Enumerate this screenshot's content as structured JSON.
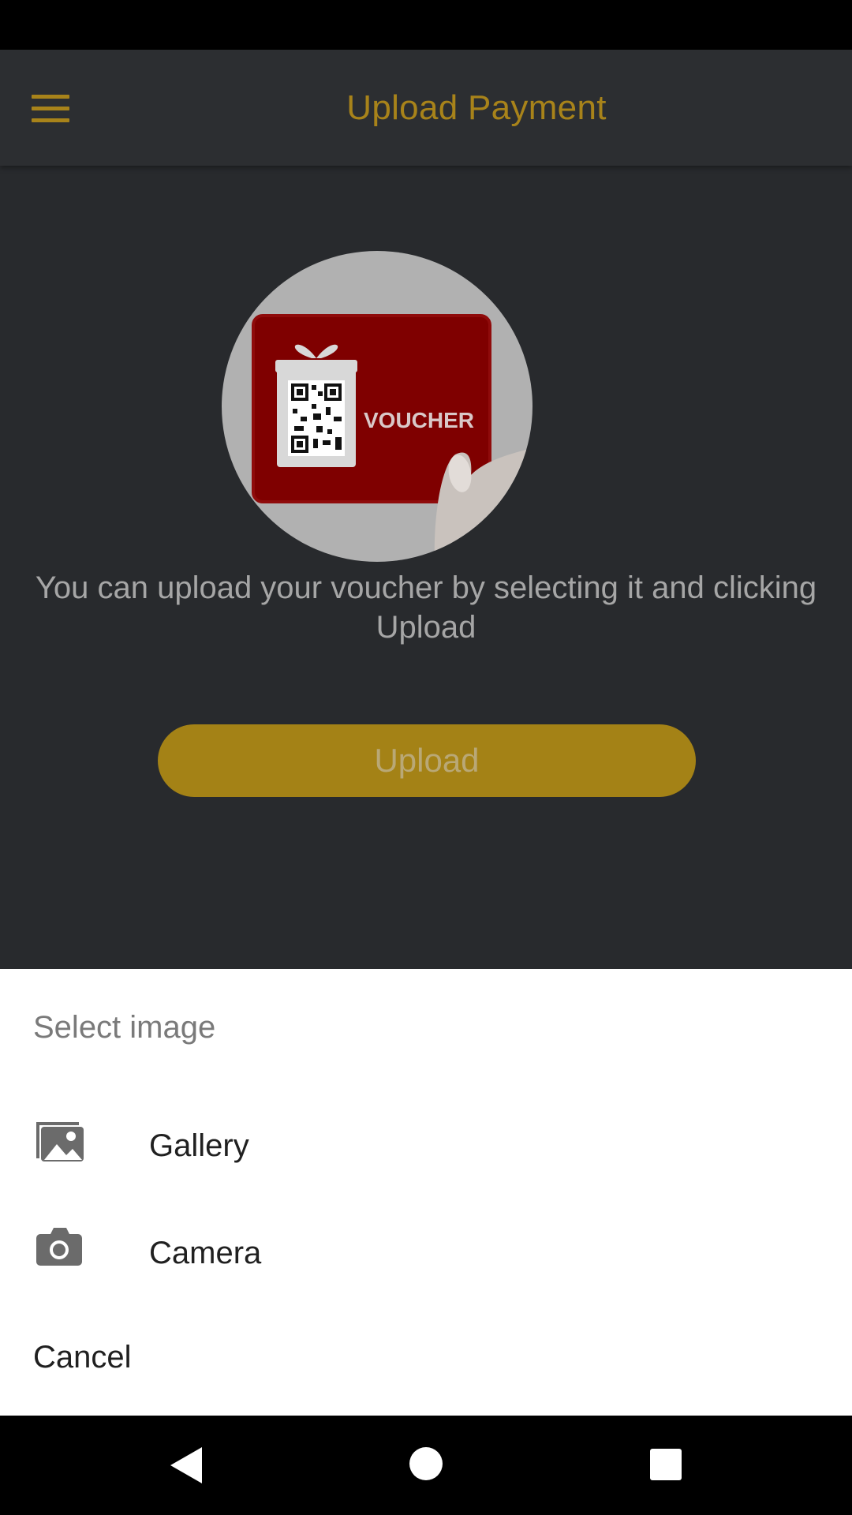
{
  "app_bar": {
    "title": "Upload Payment",
    "menu_icon": "hamburger-menu-icon",
    "accent_color": "#a8831a"
  },
  "main": {
    "image_text": "VOUCHER",
    "instructions": "You can upload your voucher by selecting it and clicking Upload",
    "upload_button_label": "Upload"
  },
  "sheet": {
    "title": "Select image",
    "items": [
      {
        "label": "Gallery",
        "icon": "gallery-icon"
      },
      {
        "label": "Camera",
        "icon": "camera-icon"
      }
    ],
    "cancel_label": "Cancel"
  },
  "nav_bar": {
    "back_icon": "back-triangle-icon",
    "home_icon": "home-circle-icon",
    "recents_icon": "recents-square-icon"
  }
}
